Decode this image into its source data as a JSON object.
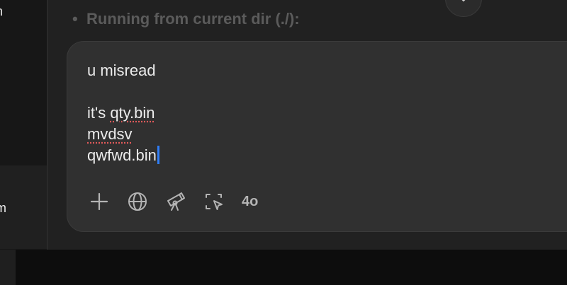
{
  "sidebar": {
    "top_item_fragment": "n",
    "active_item_fragment": "m"
  },
  "chat": {
    "bullet": "•",
    "last_line": "Running from current dir (./):"
  },
  "composer": {
    "lines": [
      "u misread",
      "",
      "it's",
      "qty.bin",
      "mvdsv",
      "qwfwd.bin"
    ],
    "line1": "u misread",
    "line3_prefix": "it's ",
    "line3_word": "qty.bin",
    "line4": "mvdsv",
    "line5": "qwfwd.bin"
  },
  "toolbar": {
    "tools": [
      "plus-icon",
      "globe-icon",
      "telescope-icon",
      "screen-select-icon"
    ],
    "model": "4o"
  },
  "icons": {
    "scroll_down": "arrow-down-icon"
  },
  "colors": {
    "background": "#212121",
    "composer": "#303030",
    "cursor": "#2f7df6",
    "spellcheck": "#e05a5a"
  }
}
